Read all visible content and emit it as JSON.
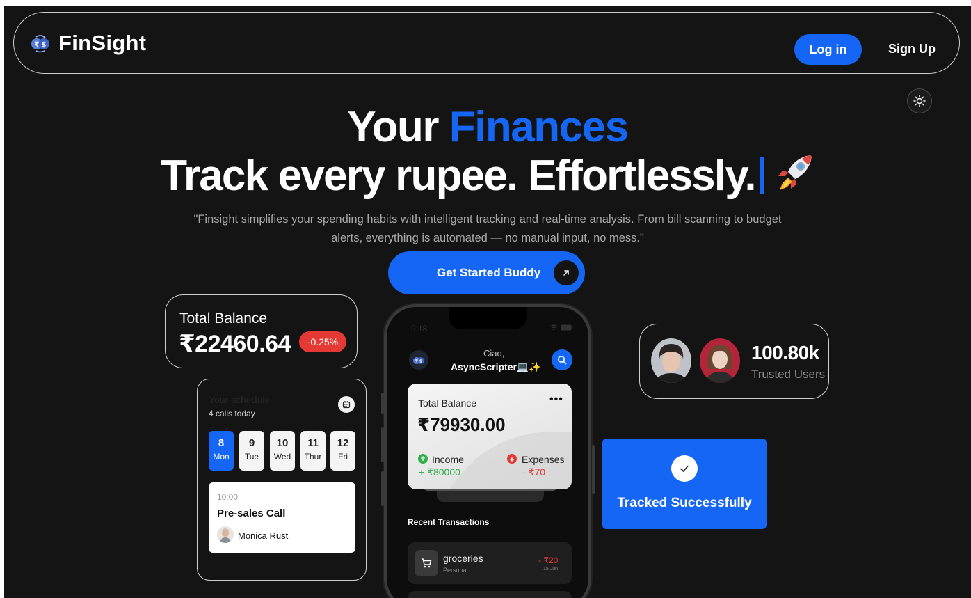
{
  "nav": {
    "brand": "FinSight",
    "login_label": "Log in",
    "signup_label": "Sign Up"
  },
  "hero": {
    "line1_prefix": "Your ",
    "line1_accent": "Finances",
    "line2": "Track every rupee. Effortlessly.",
    "description": "\"Finsight simplifies your spending habits with intelligent tracking and real-time analysis. From bill scanning to budget alerts, everything is automated — no manual input, no mess.\"",
    "cta_label": "Get Started Buddy"
  },
  "balance_card": {
    "title": "Total Balance",
    "amount": "₹22460.64",
    "change": "-0.25%"
  },
  "schedule": {
    "title": "Your schedule",
    "subtitle": "4 calls today",
    "days": [
      {
        "num": "8",
        "name": "Mon",
        "active": true
      },
      {
        "num": "9",
        "name": "Tue",
        "active": false
      },
      {
        "num": "10",
        "name": "Wed",
        "active": false
      },
      {
        "num": "11",
        "name": "Thur",
        "active": false
      },
      {
        "num": "12",
        "name": "Fri",
        "active": false
      }
    ],
    "meeting": {
      "time": "10:00",
      "title": "Pre-sales Call",
      "person": "Monica Rust"
    }
  },
  "phone": {
    "time": "9:18",
    "greeting": "Ciao,",
    "username": "AsyncScripter💻✨",
    "card": {
      "title": "Total Balance",
      "amount": "₹79930.00",
      "income_label": "Income",
      "income_value": "+ ₹80000",
      "expense_label": "Expenses",
      "expense_value": "- ₹70"
    },
    "recent_title": "Recent Transactions",
    "transactions": [
      {
        "name": "groceries",
        "category": "Personal..",
        "amount": "- ₹20",
        "date": "15 Jun"
      }
    ]
  },
  "users": {
    "count": "100.80k",
    "label": "Trusted Users"
  },
  "tracked": {
    "label": "Tracked Successfully"
  },
  "colors": {
    "accent": "#1566f5",
    "background": "#141414",
    "income": "#2fae4c",
    "expense": "#e53935"
  }
}
